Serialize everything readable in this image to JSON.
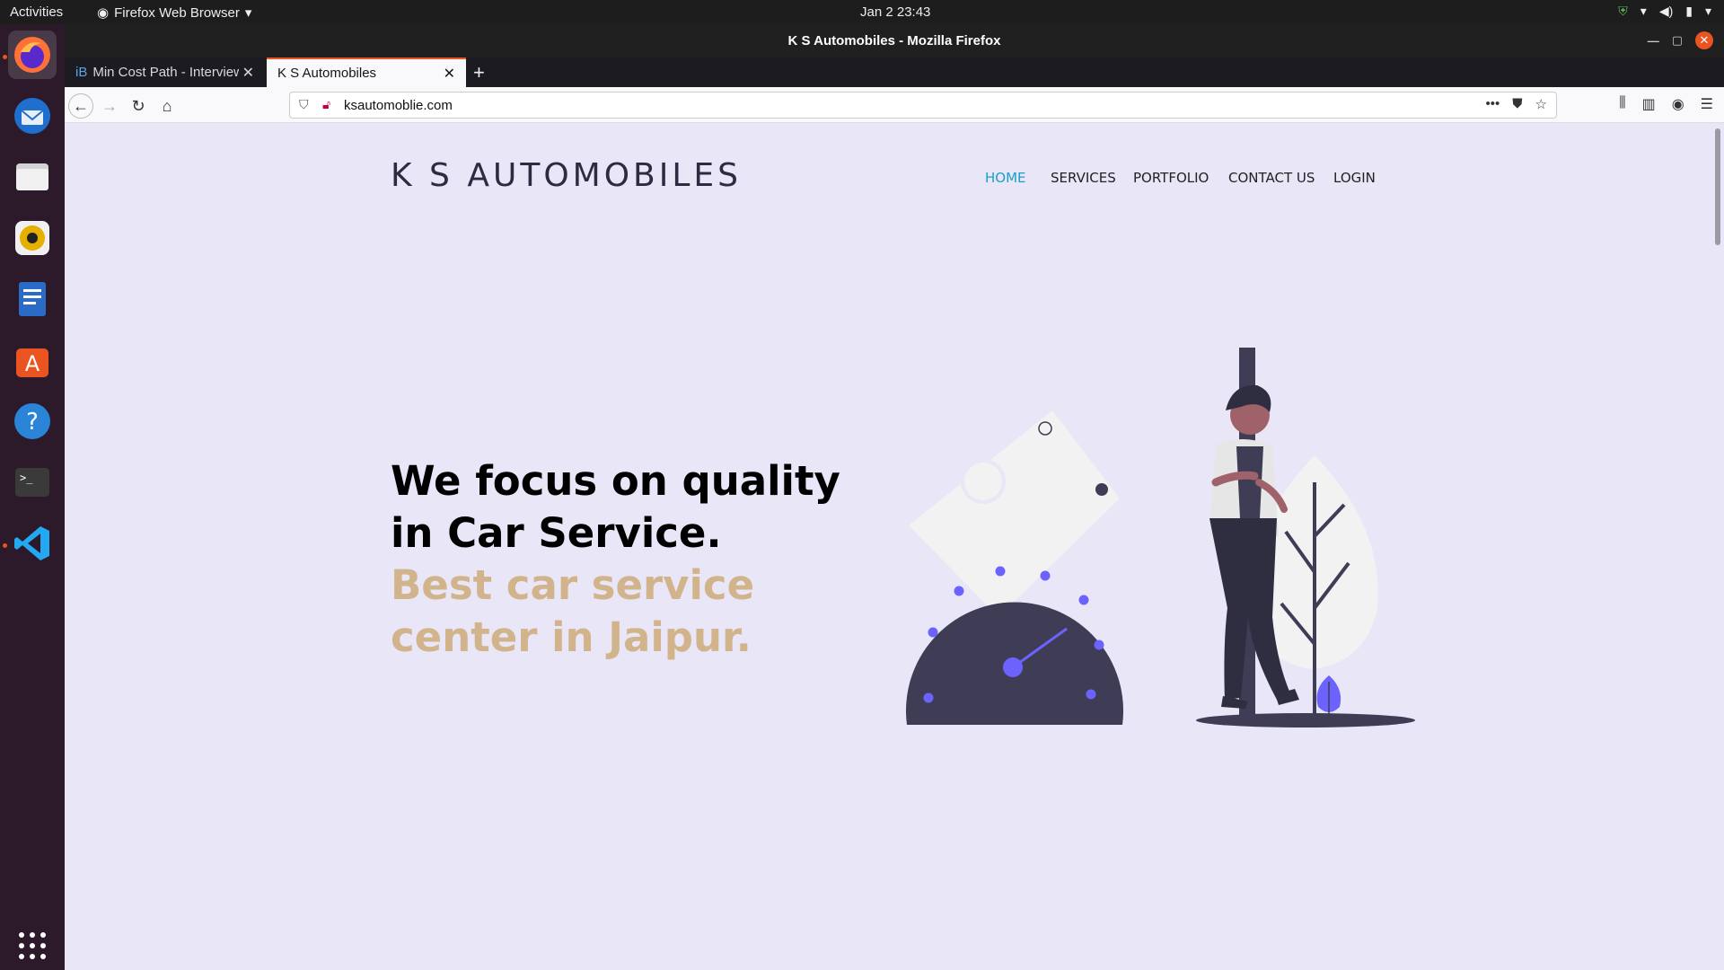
{
  "topbar": {
    "activities": "Activities",
    "app_menu": "Firefox Web Browser",
    "clock": "Jan 2  23:43"
  },
  "window": {
    "title": "K S Automobiles - Mozilla Firefox"
  },
  "tabs": [
    {
      "label": "Min Cost Path - Interview",
      "favicon": "iB"
    },
    {
      "label": "K S Automobiles"
    }
  ],
  "urlbar": {
    "url": "ksautomoblie.com"
  },
  "site": {
    "logo": "K S AUTOMOBILES",
    "nav": [
      "HOME",
      "SERVICES",
      "PORTFOLIO",
      "CONTACT US",
      "LOGIN"
    ],
    "hero_line1": "We focus on quality",
    "hero_line2": "in Car Service.",
    "hero_line3": "Best car service",
    "hero_line4": "center in Jaipur.",
    "accent_color": "#1aa0c9",
    "tagline_color": "#d2b48c",
    "illustration_accent": "#6c63ff"
  },
  "dock": [
    "firefox-icon",
    "thunderbird-icon",
    "files-icon",
    "rhythmbox-icon",
    "writer-icon",
    "software-icon",
    "help-icon",
    "terminal-icon",
    "vscode-icon",
    "app-grid-icon"
  ]
}
